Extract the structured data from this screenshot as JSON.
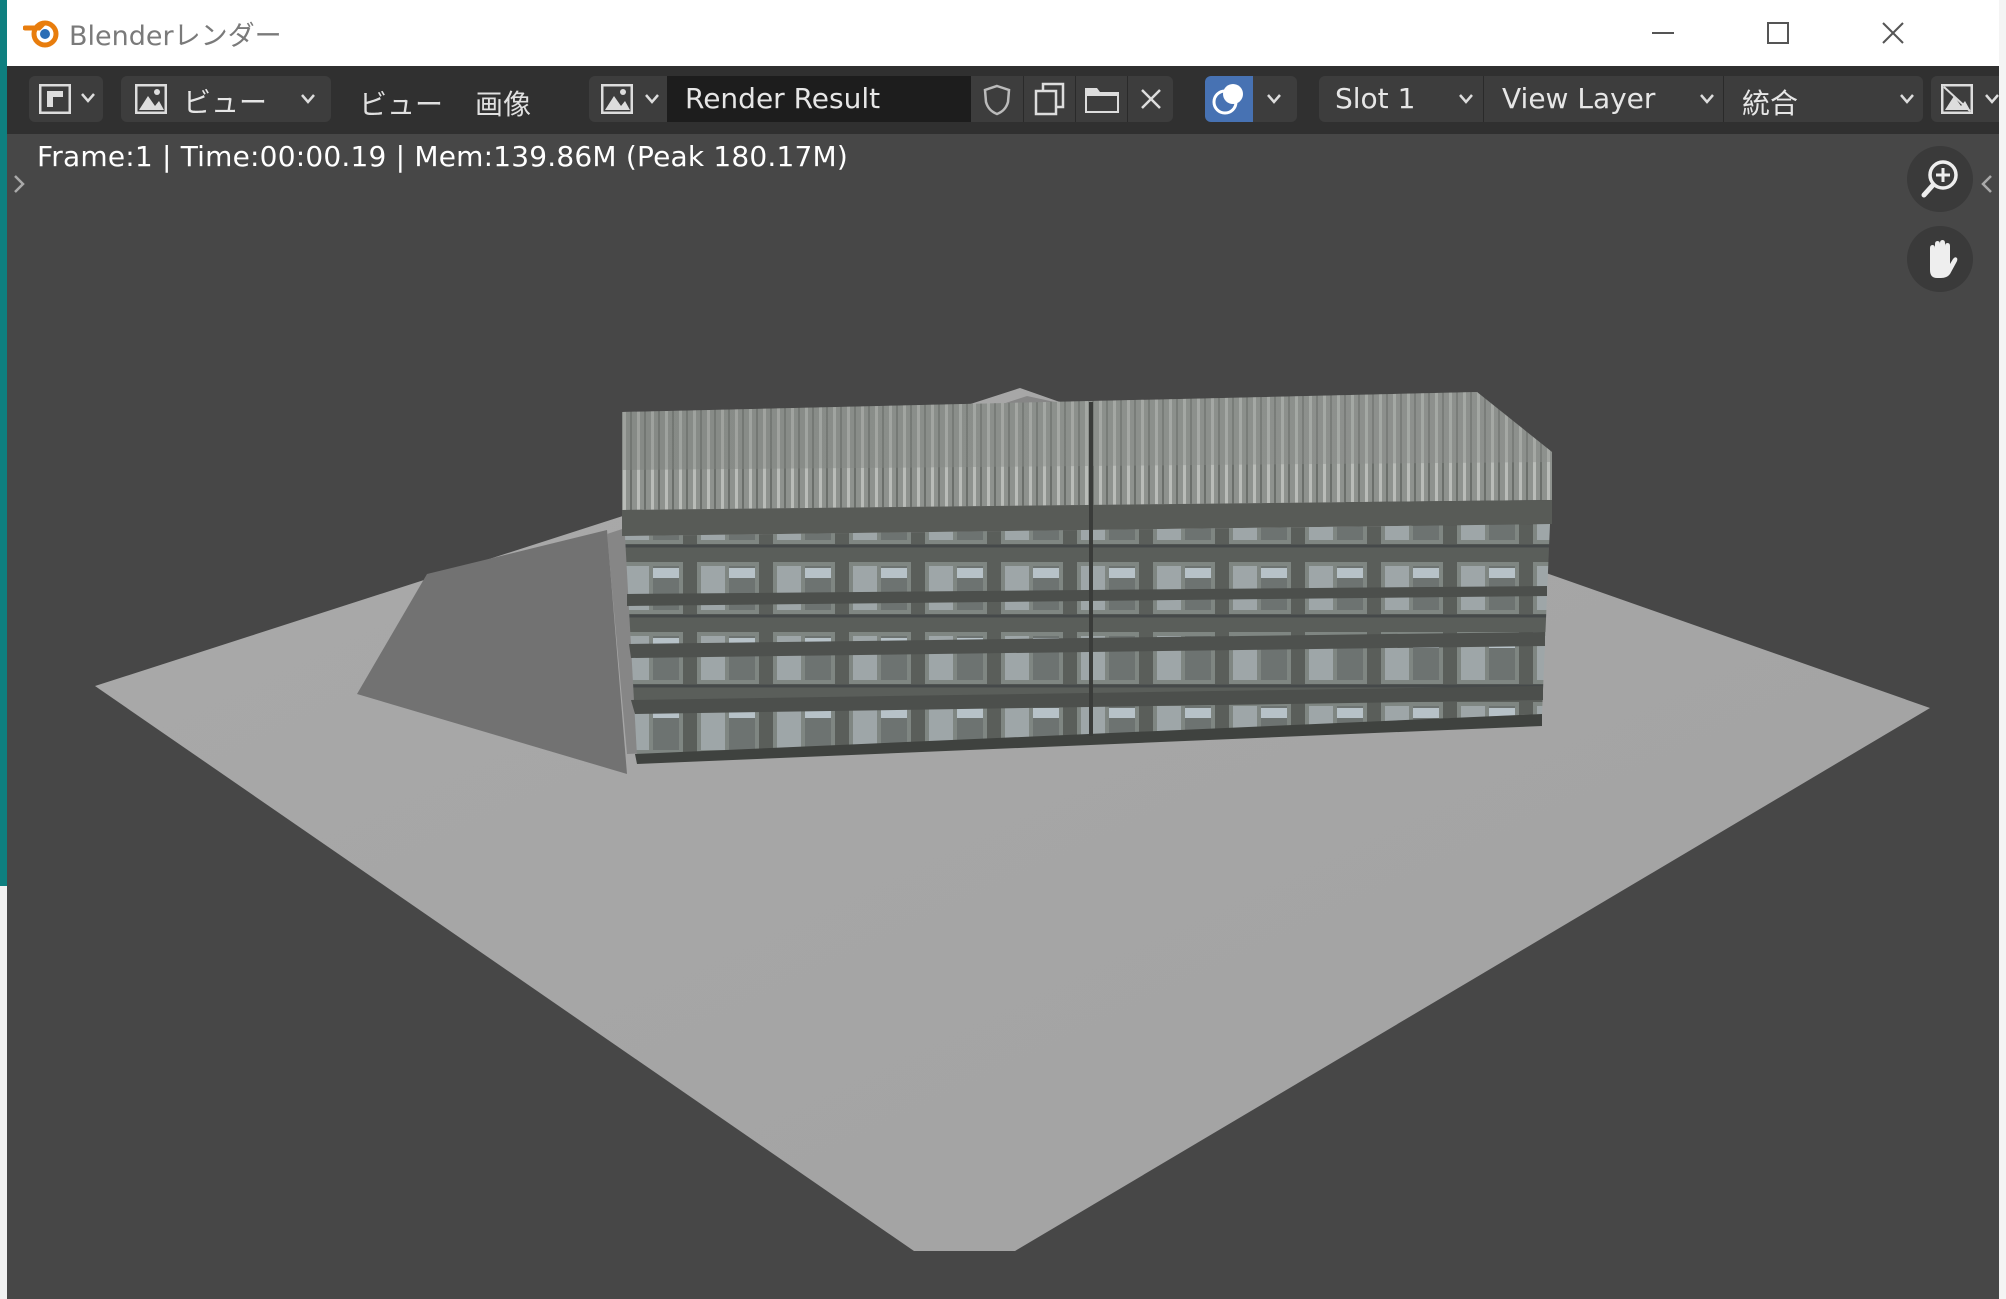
{
  "window": {
    "title": "Blenderレンダー",
    "minimize_icon": "minimize-icon",
    "maximize_icon": "maximize-icon",
    "close_icon": "close-icon"
  },
  "header": {
    "editor_type_icon": "image-editor-icon",
    "mode_label": "ビュー",
    "menus": [
      "ビュー",
      "画像"
    ],
    "image_name": "Render Result",
    "slot_label": "Slot 1",
    "view_layer_label": "View Layer",
    "pass_label": "統合",
    "colors": {
      "accent": "#4772b3",
      "header_bg": "#303030",
      "field_bg": "#3d3d3d"
    }
  },
  "status": {
    "text": "Frame:1 | Time:00:00.19 | Mem:139.86M (Peak 180.17M)"
  },
  "viewport": {
    "background": "#474747",
    "zoom_icon": "zoom-in-icon",
    "pan_icon": "hand-pan-icon"
  }
}
